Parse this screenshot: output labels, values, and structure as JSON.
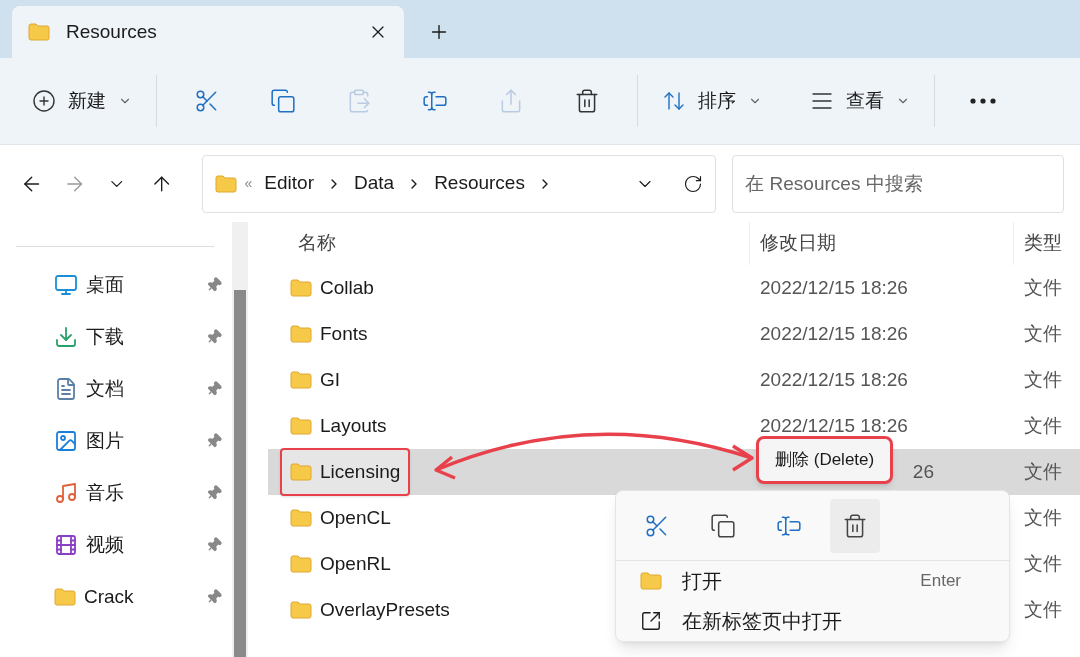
{
  "tabs": [
    {
      "title": "Resources",
      "selected": true
    }
  ],
  "toolbar": [
    {
      "kind": "menu",
      "label": "新建"
    },
    {
      "kind": "icon",
      "disabled": false
    },
    {
      "kind": "icon",
      "disabled": false
    },
    {
      "kind": "icon",
      "disabled": true
    },
    {
      "kind": "icon",
      "disabled": false
    },
    {
      "kind": "icon",
      "disabled": true
    },
    {
      "kind": "icon",
      "disabled": false
    },
    {
      "kind": "menu",
      "label": "排序"
    },
    {
      "kind": "menu",
      "label": "查看"
    },
    {
      "kind": "more"
    }
  ],
  "address": {
    "overflow": "«",
    "crumbs": [
      "Editor",
      "Data",
      "Resources"
    ]
  },
  "search": {
    "placeholder": "在 Resources 中搜索"
  },
  "sidebar": {
    "items": [
      {
        "label": "桌面",
        "pinned": true
      },
      {
        "label": "下载",
        "pinned": true
      },
      {
        "label": "文档",
        "pinned": true
      },
      {
        "label": "图片",
        "pinned": true
      },
      {
        "label": "音乐",
        "pinned": true
      },
      {
        "label": "视频",
        "pinned": true
      },
      {
        "label": "Crack",
        "pinned": true
      }
    ]
  },
  "table": {
    "columns": [
      "名称",
      "修改日期",
      "类型"
    ],
    "rows": [
      {
        "name": "Collab",
        "date": "2022/12/15 18:26",
        "type": "文件",
        "selected": false
      },
      {
        "name": "Fonts",
        "date": "2022/12/15 18:26",
        "type": "文件",
        "selected": false
      },
      {
        "name": "GI",
        "date": "2022/12/15 18:26",
        "type": "文件",
        "selected": false
      },
      {
        "name": "Layouts",
        "date": "2022/12/15 18:26",
        "type": "文件",
        "selected": false
      },
      {
        "name": "Licensing",
        "date": "26",
        "type": "文件",
        "selected": true
      },
      {
        "name": "OpenCL",
        "type": "文件",
        "selected": false
      },
      {
        "name": "OpenRL",
        "type": "文件",
        "selected": false
      },
      {
        "name": "OverlayPresets",
        "type": "文件",
        "selected": false
      }
    ]
  },
  "tooltip": {
    "text": "删除 (Delete)"
  },
  "context_menu": {
    "icon_buttons": [
      {
        "hovered": false
      },
      {
        "hovered": false
      },
      {
        "hovered": false
      },
      {
        "hovered": true
      }
    ],
    "items": [
      {
        "label": "打开",
        "shortcut": "Enter"
      },
      {
        "label": "在新标签页中打开"
      }
    ]
  }
}
